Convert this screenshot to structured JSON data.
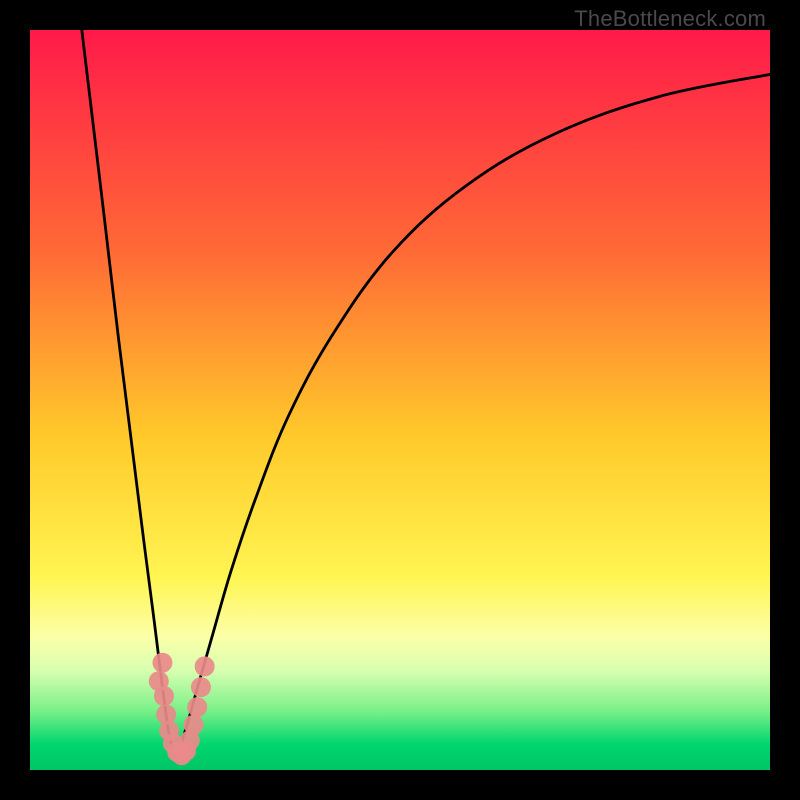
{
  "watermark": "TheBottleneck.com",
  "chart_data": {
    "type": "line",
    "title": "",
    "xlabel": "",
    "ylabel": "",
    "xlim": [
      0,
      100
    ],
    "ylim": [
      0,
      100
    ],
    "grid": false,
    "legend": false,
    "gradient_stops": [
      {
        "offset": 0.0,
        "color": "#ff1a49"
      },
      {
        "offset": 0.3,
        "color": "#ff6a36"
      },
      {
        "offset": 0.55,
        "color": "#ffca2a"
      },
      {
        "offset": 0.74,
        "color": "#fff552"
      },
      {
        "offset": 0.82,
        "color": "#fcffa8"
      },
      {
        "offset": 0.865,
        "color": "#d8ffb0"
      },
      {
        "offset": 0.92,
        "color": "#7af089"
      },
      {
        "offset": 0.965,
        "color": "#00d66e"
      },
      {
        "offset": 1.0,
        "color": "#00c566"
      }
    ],
    "series": [
      {
        "name": "left-curve",
        "x": [
          7.0,
          10.0,
          12.0,
          14.0,
          15.5,
          16.8,
          17.8,
          18.6,
          19.2,
          19.6
        ],
        "y": [
          100,
          75,
          58,
          42,
          30,
          20,
          12,
          6,
          3,
          1.5
        ]
      },
      {
        "name": "right-curve",
        "x": [
          19.6,
          20.2,
          21.2,
          22.6,
          24.6,
          27.2,
          30.6,
          35.0,
          41.0,
          49.0,
          59.0,
          71.0,
          85.0,
          100.0
        ],
        "y": [
          1.5,
          3,
          6,
          11,
          18,
          27,
          37,
          48,
          59,
          70,
          79,
          86,
          91,
          94
        ]
      },
      {
        "name": "marker-cluster",
        "type": "scatter",
        "points": [
          {
            "x": 17.9,
            "y": 14.5
          },
          {
            "x": 17.4,
            "y": 12.0
          },
          {
            "x": 18.1,
            "y": 10.0
          },
          {
            "x": 18.4,
            "y": 7.5
          },
          {
            "x": 18.8,
            "y": 5.3
          },
          {
            "x": 19.3,
            "y": 3.6
          },
          {
            "x": 19.9,
            "y": 2.4
          },
          {
            "x": 20.5,
            "y": 2.0
          },
          {
            "x": 21.1,
            "y": 2.6
          },
          {
            "x": 21.6,
            "y": 4.0
          },
          {
            "x": 22.1,
            "y": 6.1
          },
          {
            "x": 22.6,
            "y": 8.5
          },
          {
            "x": 23.1,
            "y": 11.2
          },
          {
            "x": 23.6,
            "y": 14.0
          }
        ]
      }
    ]
  }
}
